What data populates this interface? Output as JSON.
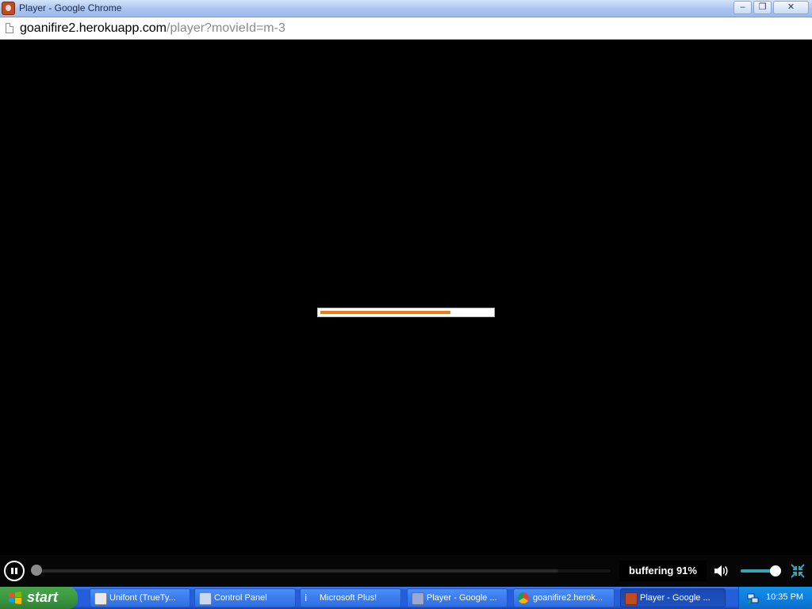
{
  "window": {
    "title": "Player - Google Chrome",
    "controls": {
      "minimize": "–",
      "restore": "❐",
      "close": "✕"
    }
  },
  "address_bar": {
    "url_host": "goanifire2.herokuapp.com",
    "url_path": "/player?movieId=m-3",
    "page_icon": "page-icon"
  },
  "player": {
    "loading_progress_fraction": 0.76,
    "loading_fill_color": "#ef7d14",
    "seek_position_fraction": 0.0,
    "seek_buffered_fraction": 0.91,
    "buffering_text": "buffering 91%",
    "volume_fraction": 0.85,
    "volume_color": "#35a4b4",
    "icons": {
      "play_pause": "pause-icon",
      "volume": "speaker-icon",
      "fullscreen": "exit-fullscreen-icon"
    }
  },
  "taskbar": {
    "start_label": "start",
    "tasks": [
      {
        "label": "Unifont (TrueTy...",
        "icon": "font-icon",
        "active": false
      },
      {
        "label": "Control Panel",
        "icon": "control-panel-icon",
        "active": false
      },
      {
        "label": "Microsoft Plus!",
        "icon": "plus-icon",
        "active": false
      },
      {
        "label": "Player - Google ...",
        "icon": "player-icon",
        "active": false
      },
      {
        "label": "goanifire2.herok...",
        "icon": "chrome-icon",
        "active": false
      },
      {
        "label": "Player - Google ...",
        "icon": "player-app-icon",
        "active": true
      }
    ],
    "clock": "10:35 PM"
  }
}
